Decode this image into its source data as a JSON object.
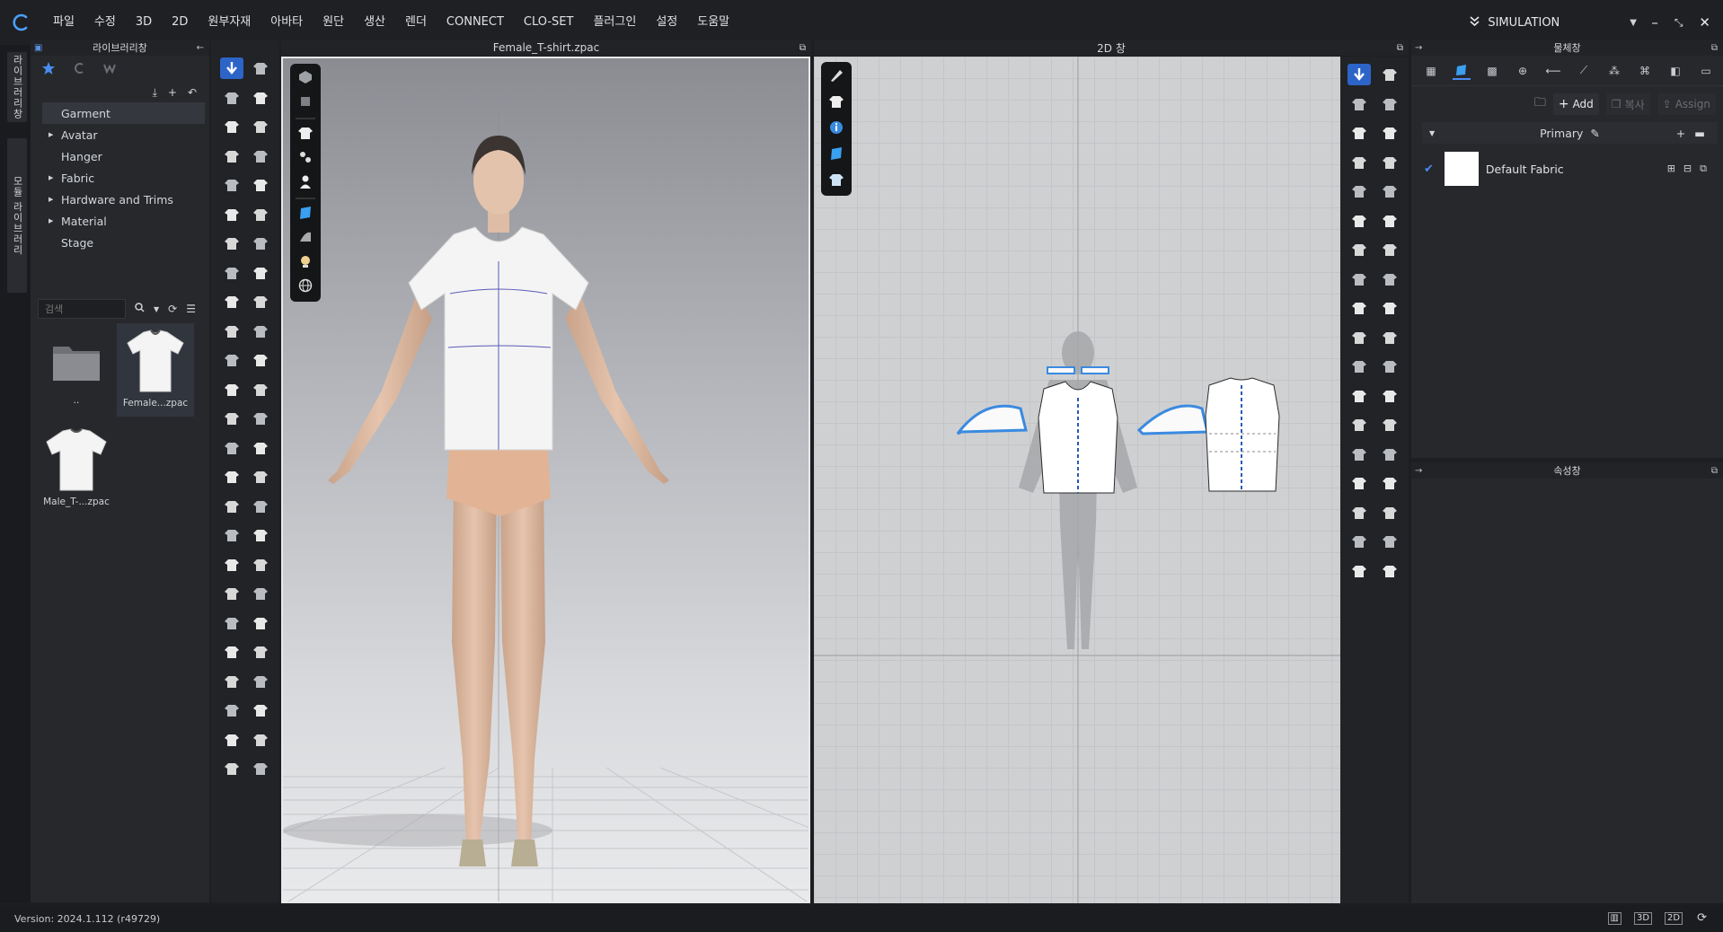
{
  "menu": [
    "파일",
    "수정",
    "3D",
    "2D",
    "원부자재",
    "아바타",
    "원단",
    "생산",
    "렌더",
    "CONNECT",
    "CLO-SET",
    "플러그인",
    "설정",
    "도움말"
  ],
  "mode": {
    "label": "SIMULATION"
  },
  "vertical_tabs": [
    "라이브러리창",
    "모듈 라이브러리"
  ],
  "library": {
    "title": "라이브러리창",
    "tree": [
      {
        "label": "Garment",
        "expandable": false,
        "selected": true
      },
      {
        "label": "Avatar",
        "expandable": true
      },
      {
        "label": "Hanger",
        "expandable": false
      },
      {
        "label": "Fabric",
        "expandable": true
      },
      {
        "label": "Hardware and Trims",
        "expandable": true
      },
      {
        "label": "Material",
        "expandable": true
      },
      {
        "label": "Stage",
        "expandable": false
      }
    ],
    "search_placeholder": "검색",
    "thumbs": [
      {
        "caption": ".."
      },
      {
        "caption": "Female...zpac"
      },
      {
        "caption": "Male_T-...zpac"
      }
    ]
  },
  "viewport3d": {
    "title": "Female_T-shirt.zpac"
  },
  "viewport2d": {
    "title": "2D 창"
  },
  "object_browser": {
    "title": "물체창",
    "add_label": "Add",
    "copy_label": "복사",
    "assign_label": "Assign",
    "group_label": "Primary",
    "fabric_name": "Default Fabric",
    "swatch_color": "#ffffff"
  },
  "property_panel": {
    "title": "속성창"
  },
  "status": {
    "version": "Version: 2024.1.112 (r49729)"
  },
  "colors": {
    "accent": "#2d64c8",
    "background": "#1d1e21"
  }
}
